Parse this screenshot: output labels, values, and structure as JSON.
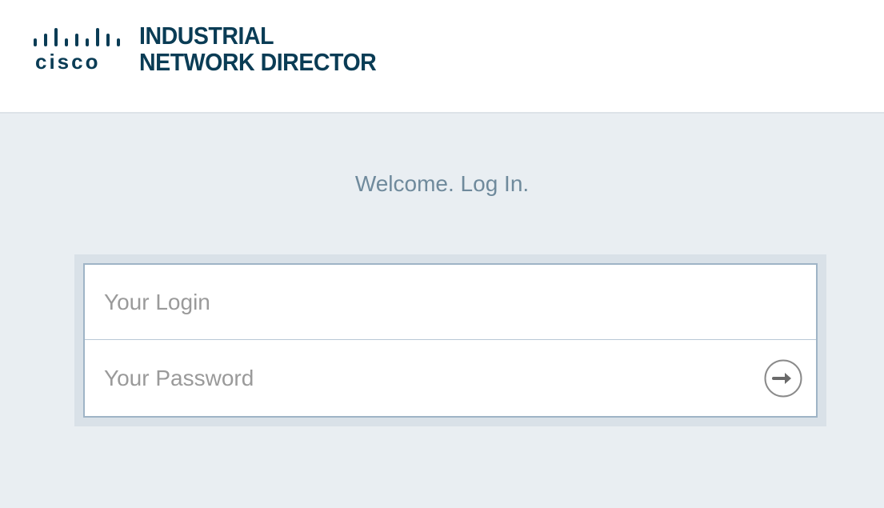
{
  "header": {
    "logo": {
      "brand": "cisco",
      "product_line1": "INDUSTRIAL",
      "product_line2": "NETWORK DIRECTOR",
      "icon": "cisco-bars-icon",
      "color": "#0a3c55"
    }
  },
  "login": {
    "welcome_text": "Welcome. Log In.",
    "login_placeholder": "Your Login",
    "login_value": "",
    "password_placeholder": "Your Password",
    "password_value": "",
    "submit_icon": "arrow-right-circle-icon"
  },
  "colors": {
    "background": "#e9eef2",
    "welcome_text": "#6f8a9c",
    "input_border": "#9fb4c6"
  }
}
